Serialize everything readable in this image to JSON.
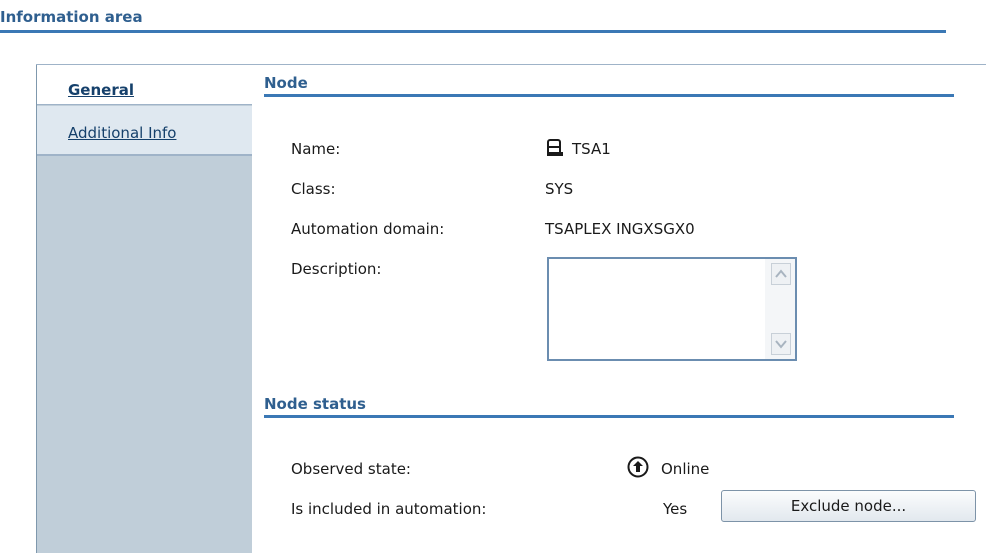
{
  "area_title": "Information area",
  "tabs": [
    {
      "label": "General",
      "selected": true
    },
    {
      "label": "Additional Info",
      "selected": false
    }
  ],
  "node": {
    "title": "Node",
    "fields": {
      "name_label": "Name:",
      "name_value": "TSA1",
      "class_label": "Class:",
      "class_value": "SYS",
      "domain_label": "Automation domain:",
      "domain_value": "TSAPLEX INGXSGX0",
      "description_label": "Description:",
      "description_value": ""
    }
  },
  "node_status": {
    "title": "Node status",
    "observed_label": "Observed state:",
    "observed_value": "Online",
    "included_label": "Is included in automation:",
    "included_value": "Yes",
    "exclude_button": "Exclude node..."
  },
  "icons": {
    "node": "server-node-icon",
    "state": "online-up-arrow-icon"
  }
}
